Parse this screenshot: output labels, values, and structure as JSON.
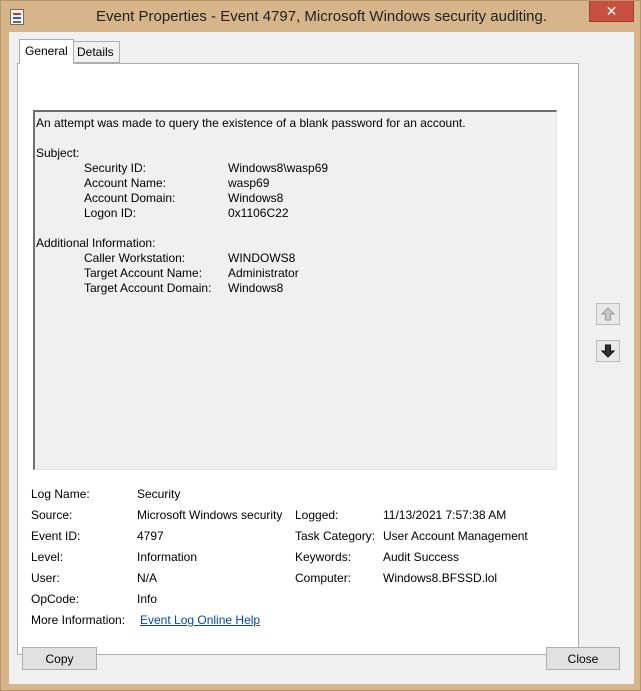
{
  "window": {
    "title": "Event Properties - Event 4797, Microsoft Windows security auditing.",
    "close_glyph": "✕"
  },
  "tabs": [
    {
      "label": "General"
    },
    {
      "label": "Details"
    }
  ],
  "description": {
    "intro": "An attempt was made to query the existence of a blank password for an account.",
    "subject_header": "Subject:",
    "subject": [
      {
        "label": "Security ID:",
        "value": "Windows8\\wasp69"
      },
      {
        "label": "Account Name:",
        "value": "wasp69"
      },
      {
        "label": "Account Domain:",
        "value": "Windows8"
      },
      {
        "label": "Logon ID:",
        "value": "0x1106C22"
      }
    ],
    "additional_header": "Additional Information:",
    "additional": [
      {
        "label": "Caller Workstation:",
        "value": "WINDOWS8"
      },
      {
        "label": "Target Account Name:",
        "value": "Administrator"
      },
      {
        "label": "Target Account Domain:",
        "value": "Windows8"
      }
    ]
  },
  "info": {
    "log_name": {
      "label": "Log Name:",
      "value": "Security"
    },
    "source": {
      "label": "Source:",
      "value": "Microsoft Windows security"
    },
    "logged": {
      "label": "Logged:",
      "value": "11/13/2021 7:57:38 AM"
    },
    "event_id": {
      "label": "Event ID:",
      "value": "4797"
    },
    "task_category": {
      "label": "Task Category:",
      "value": "User Account Management"
    },
    "level": {
      "label": "Level:",
      "value": "Information"
    },
    "keywords": {
      "label": "Keywords:",
      "value": "Audit Success"
    },
    "user": {
      "label": "User:",
      "value": "N/A"
    },
    "computer": {
      "label": "Computer:",
      "value": "Windows8.BFSSD.lol"
    },
    "opcode": {
      "label": "OpCode:",
      "value": "Info"
    },
    "more_info": {
      "label": "More Information:",
      "link": "Event Log Online Help"
    }
  },
  "buttons": {
    "copy": "Copy",
    "close": "Close"
  },
  "icons": {
    "up": "up-arrow-icon",
    "down": "down-arrow-icon"
  }
}
